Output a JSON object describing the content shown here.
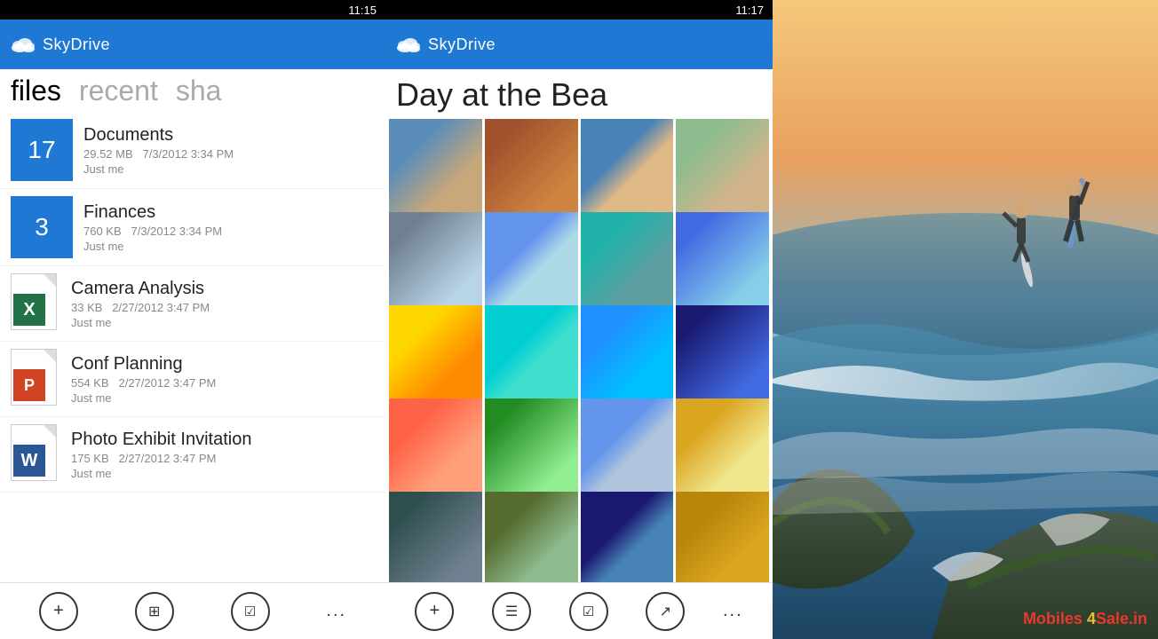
{
  "panel1": {
    "status_time": "11:15",
    "app_name": "SkyDrive",
    "nav_tabs": [
      {
        "label": "files",
        "active": true
      },
      {
        "label": "recent",
        "active": false
      },
      {
        "label": "sha",
        "active": false
      }
    ],
    "files": [
      {
        "id": "documents",
        "type": "folder",
        "name": "Documents",
        "count": "17",
        "size": "29.52 MB",
        "date": "7/3/2012 3:34 PM",
        "owner": "Just me"
      },
      {
        "id": "finances",
        "type": "folder",
        "name": "Finances",
        "count": "3",
        "size": "760 KB",
        "date": "7/3/2012 3:34 PM",
        "owner": "Just me"
      },
      {
        "id": "camera-analysis",
        "type": "excel",
        "name": "Camera Analysis",
        "size": "33 KB",
        "date": "2/27/2012 3:47 PM",
        "owner": "Just me"
      },
      {
        "id": "conf-planning",
        "type": "ppt",
        "name": "Conf Planning",
        "size": "554 KB",
        "date": "2/27/2012 3:47 PM",
        "owner": "Just me"
      },
      {
        "id": "photo-exhibit",
        "type": "word",
        "name": "Photo Exhibit Invitation",
        "size": "175 KB",
        "date": "2/27/2012 3:47 PM",
        "owner": "Just me"
      }
    ],
    "toolbar": {
      "add": "+",
      "grid": "⊞",
      "check": "☑",
      "more": "..."
    }
  },
  "panel2": {
    "status_time": "11:17",
    "app_name": "SkyDrive",
    "title": "Day at the Bea",
    "photo_count": 20,
    "toolbar": {
      "add": "+",
      "list": "☰",
      "check": "☑",
      "share": "↗",
      "more": "..."
    }
  },
  "panel3": {
    "watermark": "Mobiles 4Sale.in"
  }
}
